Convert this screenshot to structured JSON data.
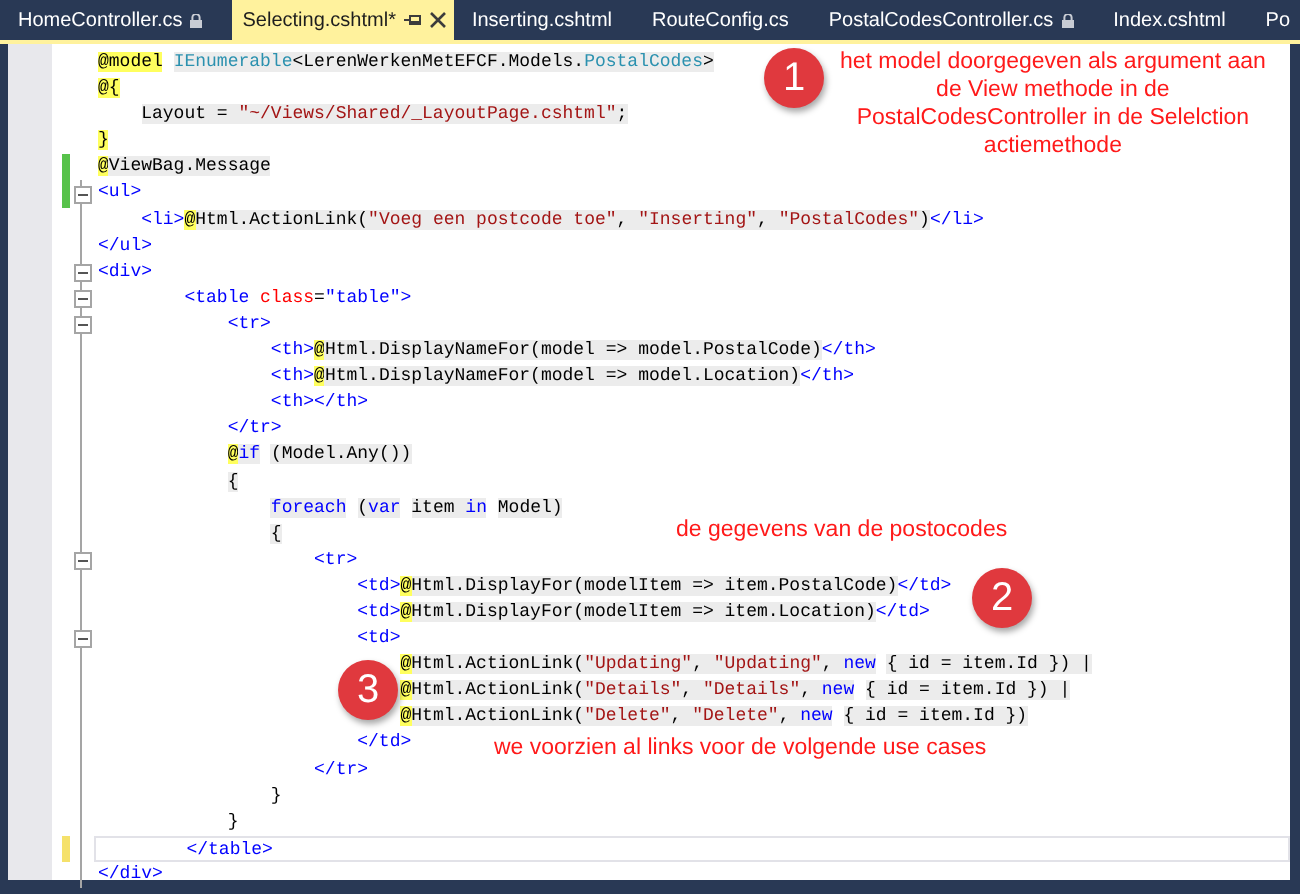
{
  "tabs": [
    {
      "label": "HomeController.cs",
      "selected": false,
      "locked": true
    },
    {
      "label": "Selecting.cshtml*",
      "selected": true,
      "locked": false
    },
    {
      "label": "Inserting.cshtml",
      "selected": false,
      "locked": false
    },
    {
      "label": "RouteConfig.cs",
      "selected": false,
      "locked": false
    },
    {
      "label": "PostalCodesController.cs",
      "selected": false,
      "locked": true
    },
    {
      "label": "Index.cshtml",
      "selected": false,
      "locked": false
    },
    {
      "label": "Po",
      "selected": false,
      "locked": false
    }
  ],
  "editor": {
    "lines": [
      {
        "fold": false,
        "current": false,
        "segs": [
          {
            "text": "@model",
            "kind": "at"
          },
          {
            "text": "IEnumerable",
            "kind": "codetype"
          },
          {
            "text": "<LerenWerkenMetEFCF.Models.",
            "kind": "code"
          },
          {
            "text": "PostalCodes",
            "kind": "codetype"
          },
          {
            "text": ">",
            "kind": "code"
          }
        ]
      },
      {
        "fold": false,
        "current": false,
        "segs": [
          {
            "text": "@{",
            "kind": "at"
          }
        ]
      },
      {
        "fold": false,
        "current": false,
        "segs": [
          {
            "text": "    Layout = ",
            "kind": "code"
          },
          {
            "text": "\"~/Views/Shared/_LayoutPage.cshtml\"",
            "kind": "codestr"
          },
          {
            "text": ";",
            "kind": "code"
          }
        ]
      },
      {
        "fold": false,
        "current": false,
        "segs": [
          {
            "text": "}",
            "kind": "at"
          }
        ]
      },
      {
        "fold": false,
        "current": false,
        "saved": true,
        "segs": [
          {
            "text": "@",
            "kind": "at"
          },
          {
            "text": "ViewBag.Message",
            "kind": "code"
          }
        ]
      },
      {
        "fold": true,
        "current": false,
        "saved": true,
        "segs": [
          {
            "text": "<ul>",
            "kind": "tag"
          }
        ]
      },
      {
        "fold": false,
        "current": false,
        "segs": [
          {
            "text": "    <li>",
            "kind": "tag"
          },
          {
            "text": "@",
            "kind": "at"
          },
          {
            "text": "Html.ActionLink(",
            "kind": "code"
          },
          {
            "text": "\"Voeg een postcode toe\"",
            "kind": "codestr"
          },
          {
            "text": ", ",
            "kind": "code"
          },
          {
            "text": "\"Inserting\"",
            "kind": "codestr"
          },
          {
            "text": ", ",
            "kind": "code"
          },
          {
            "text": "\"PostalCodes\"",
            "kind": "codestr"
          },
          {
            "text": ")",
            "kind": "code"
          },
          {
            "text": "</li>",
            "kind": "tag"
          }
        ]
      },
      {
        "fold": false,
        "current": false,
        "segs": [
          {
            "text": "</ul>",
            "kind": "tag"
          }
        ]
      },
      {
        "fold": true,
        "current": false,
        "segs": [
          {
            "text": "<div>",
            "kind": "tag"
          }
        ]
      },
      {
        "fold": true,
        "current": false,
        "segs": [
          {
            "text": "        <table ",
            "kind": "tag"
          },
          {
            "text": "class",
            "kind": "attr"
          },
          {
            "text": "=",
            "kind": "plain"
          },
          {
            "text": "\"table\">",
            "kind": "tag"
          }
        ]
      },
      {
        "fold": true,
        "current": false,
        "segs": [
          {
            "text": "            <tr>",
            "kind": "tag"
          }
        ]
      },
      {
        "fold": false,
        "current": false,
        "segs": [
          {
            "text": "                <th>",
            "kind": "tag"
          },
          {
            "text": "@",
            "kind": "at"
          },
          {
            "text": "Html.DisplayNameFor(model => model.PostalCode)",
            "kind": "code"
          },
          {
            "text": "</th>",
            "kind": "tag"
          }
        ]
      },
      {
        "fold": false,
        "current": false,
        "segs": [
          {
            "text": "                <th>",
            "kind": "tag"
          },
          {
            "text": "@",
            "kind": "at"
          },
          {
            "text": "Html.DisplayNameFor(model => model.Location)",
            "kind": "code"
          },
          {
            "text": "</th>",
            "kind": "tag"
          }
        ]
      },
      {
        "fold": false,
        "current": false,
        "segs": [
          {
            "text": "                <th></th>",
            "kind": "tag"
          }
        ]
      },
      {
        "fold": false,
        "current": false,
        "segs": [
          {
            "text": "            </tr>",
            "kind": "tag"
          }
        ]
      },
      {
        "fold": false,
        "current": false,
        "segs": [
          {
            "text": "            @",
            "kind": "at"
          },
          {
            "text": "if",
            "kind": "codekw"
          },
          {
            "text": " (Model.Any())",
            "kind": "code"
          }
        ]
      },
      {
        "fold": false,
        "current": false,
        "segs": [
          {
            "text": "            {",
            "kind": "code"
          }
        ]
      },
      {
        "fold": false,
        "current": false,
        "segs": [
          {
            "text": "                foreach",
            "kind": "codekw"
          },
          {
            "text": " (",
            "kind": "code"
          },
          {
            "text": "var",
            "kind": "codekw"
          },
          {
            "text": " item ",
            "kind": "code"
          },
          {
            "text": "in",
            "kind": "codekw"
          },
          {
            "text": " Model)",
            "kind": "code"
          }
        ]
      },
      {
        "fold": false,
        "current": false,
        "segs": [
          {
            "text": "                {",
            "kind": "code"
          }
        ]
      },
      {
        "fold": true,
        "current": false,
        "segs": [
          {
            "text": "                    <tr>",
            "kind": "tag"
          }
        ]
      },
      {
        "fold": false,
        "current": false,
        "segs": [
          {
            "text": "                        <td>",
            "kind": "tag"
          },
          {
            "text": "@",
            "kind": "at"
          },
          {
            "text": "Html.DisplayFor(modelItem => item.PostalCode)",
            "kind": "code"
          },
          {
            "text": "</td>",
            "kind": "tag"
          }
        ]
      },
      {
        "fold": false,
        "current": false,
        "segs": [
          {
            "text": "                        <td>",
            "kind": "tag"
          },
          {
            "text": "@",
            "kind": "at"
          },
          {
            "text": "Html.DisplayFor(modelItem => item.Location)",
            "kind": "code"
          },
          {
            "text": "</td>",
            "kind": "tag"
          }
        ]
      },
      {
        "fold": true,
        "current": false,
        "segs": [
          {
            "text": "                        <td>",
            "kind": "tag"
          }
        ]
      },
      {
        "fold": false,
        "current": false,
        "segs": [
          {
            "text": "                            @",
            "kind": "at"
          },
          {
            "text": "Html.ActionLink(",
            "kind": "code"
          },
          {
            "text": "\"Updating\"",
            "kind": "codestr"
          },
          {
            "text": ", ",
            "kind": "code"
          },
          {
            "text": "\"Updating\"",
            "kind": "codestr"
          },
          {
            "text": ", ",
            "kind": "code"
          },
          {
            "text": "new",
            "kind": "codekw"
          },
          {
            "text": " { id = item.Id }) |",
            "kind": "code"
          }
        ]
      },
      {
        "fold": false,
        "current": false,
        "segs": [
          {
            "text": "                            @",
            "kind": "at"
          },
          {
            "text": "Html.ActionLink(",
            "kind": "code"
          },
          {
            "text": "\"Details\"",
            "kind": "codestr"
          },
          {
            "text": ", ",
            "kind": "code"
          },
          {
            "text": "\"Details\"",
            "kind": "codestr"
          },
          {
            "text": ", ",
            "kind": "code"
          },
          {
            "text": "new",
            "kind": "codekw"
          },
          {
            "text": " { id = item.Id }) |",
            "kind": "code"
          }
        ]
      },
      {
        "fold": false,
        "current": false,
        "segs": [
          {
            "text": "                            @",
            "kind": "at"
          },
          {
            "text": "Html.ActionLink(",
            "kind": "code"
          },
          {
            "text": "\"Delete\"",
            "kind": "codestr"
          },
          {
            "text": ", ",
            "kind": "code"
          },
          {
            "text": "\"Delete\"",
            "kind": "codestr"
          },
          {
            "text": ", ",
            "kind": "code"
          },
          {
            "text": "new",
            "kind": "codekw"
          },
          {
            "text": " { id = item.Id })",
            "kind": "code"
          }
        ]
      },
      {
        "fold": false,
        "current": false,
        "segs": [
          {
            "text": "                        </td>",
            "kind": "tag"
          }
        ]
      },
      {
        "fold": false,
        "current": false,
        "segs": [
          {
            "text": "                    </tr>",
            "kind": "tag"
          }
        ]
      },
      {
        "fold": false,
        "current": false,
        "segs": [
          {
            "text": "                }",
            "kind": "plain"
          }
        ]
      },
      {
        "fold": false,
        "current": false,
        "segs": [
          {
            "text": "            }",
            "kind": "plain"
          }
        ]
      },
      {
        "fold": false,
        "current": true,
        "saved": false,
        "segs": [
          {
            "text": "        </table>",
            "kind": "tag"
          }
        ]
      },
      {
        "fold": false,
        "current": false,
        "segs": [
          {
            "text": "</div>",
            "kind": "tag"
          }
        ]
      }
    ]
  },
  "callouts": [
    {
      "number": "1",
      "note": "het model doorgegeven als argument aan\nde View methode in de\nPostalCodesController in de Selelction\nactiemethode"
    },
    {
      "number": "2",
      "note": "de gegevens van de postocodes"
    },
    {
      "number": "3",
      "note": "we voorzien al links voor de volgende use cases"
    }
  ]
}
